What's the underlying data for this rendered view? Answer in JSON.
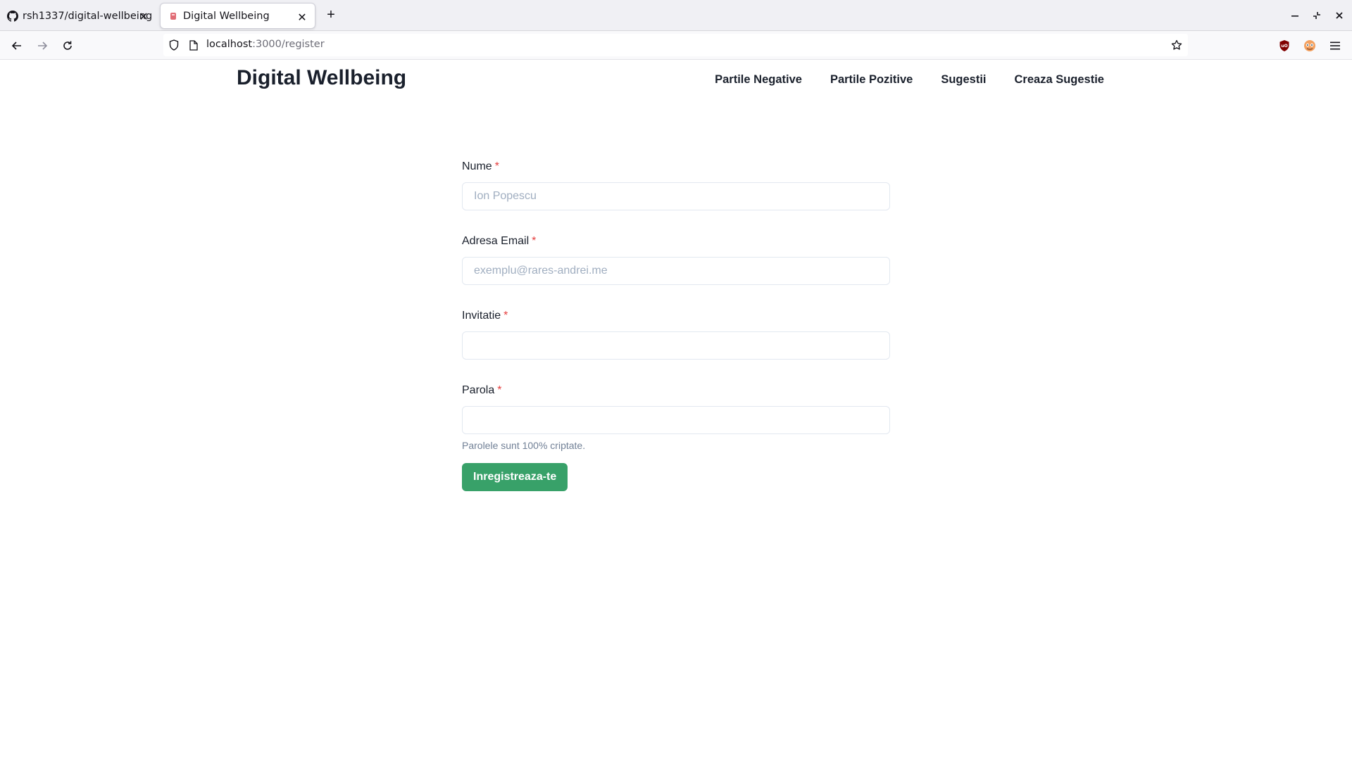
{
  "browser": {
    "tabs": [
      {
        "title": "rsh1337/digital-wellbeing",
        "icon": "github-icon"
      },
      {
        "title": "Digital Wellbeing",
        "icon": "app-favicon"
      }
    ],
    "url": {
      "host": "localhost",
      "path": ":3000/register"
    }
  },
  "site": {
    "brand": "Digital Wellbeing",
    "menu": [
      "Partile Negative",
      "Partile Pozitive",
      "Sugestii",
      "Creaza Sugestie"
    ]
  },
  "form": {
    "required_mark": "*",
    "fields": [
      {
        "label": "Nume",
        "placeholder": "Ion Popescu",
        "value": ""
      },
      {
        "label": "Adresa Email",
        "placeholder": "exemplu@rares-andrei.me",
        "value": ""
      },
      {
        "label": "Invitatie",
        "placeholder": "",
        "value": ""
      },
      {
        "label": "Parola",
        "placeholder": "",
        "value": "",
        "helper": "Parolele sunt 100% criptate."
      }
    ],
    "submit_label": "Inregistreaza-te"
  },
  "colors": {
    "brand_text": "#1a202c",
    "required": "#e53e3e",
    "submit_bg": "#38a169"
  }
}
